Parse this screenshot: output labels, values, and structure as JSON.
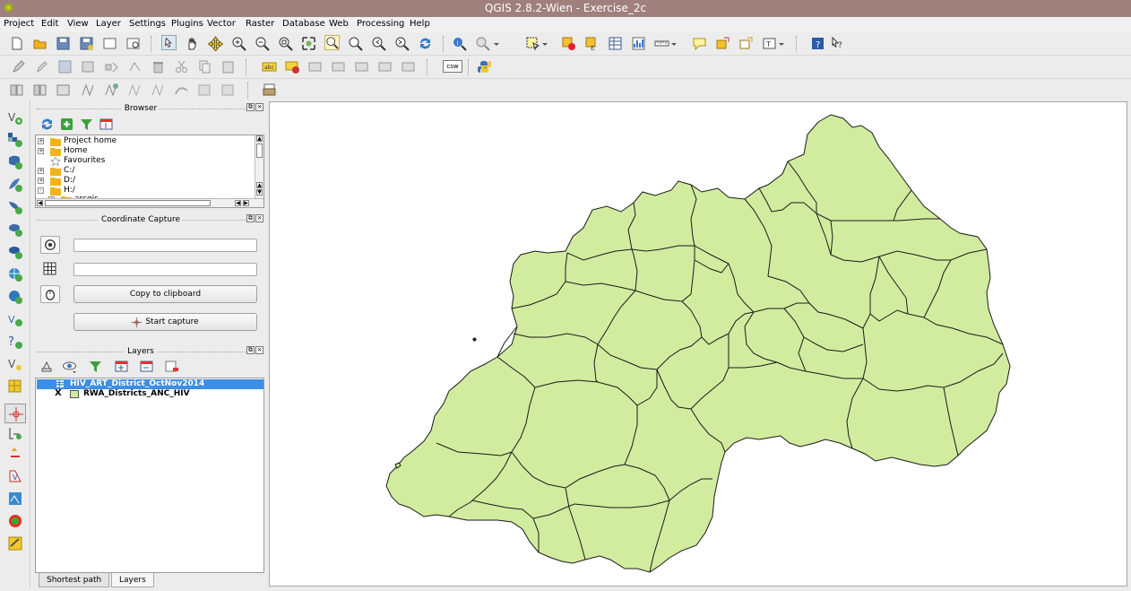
{
  "window": {
    "title": "QGIS 2.8.2-Wien - Exercise_2c"
  },
  "menu": [
    "Project",
    "Edit",
    "View",
    "Layer",
    "Settings",
    "Plugins",
    "Vector",
    "Raster",
    "Database",
    "Web",
    "Processing",
    "Help"
  ],
  "toolbar": {
    "csw_label": "csw"
  },
  "browser": {
    "title": "Browser",
    "items": [
      {
        "label": "Project home",
        "expander": "+"
      },
      {
        "label": "Home",
        "expander": "+"
      },
      {
        "label": "Favourites",
        "expander": ""
      },
      {
        "label": "C:/",
        "expander": "+"
      },
      {
        "label": "D:/",
        "expander": "+"
      },
      {
        "label": "H:/",
        "expander": "-"
      },
      {
        "label": "arcgis",
        "expander": "+"
      }
    ]
  },
  "coordinate_capture": {
    "title": "Coordinate Capture",
    "field1_value": "",
    "field2_value": "",
    "copy_label": "Copy to clipboard",
    "start_label": "Start capture"
  },
  "layers": {
    "title": "Layers",
    "items": [
      {
        "label": "HIV_ART_District_OctNov2014",
        "selected": true
      },
      {
        "label": "RWA_Districts_ANC_HIV",
        "checked": "X",
        "swatch": "#cfeaa0"
      }
    ]
  },
  "tabs": {
    "shortest_path": "Shortest path",
    "layers": "Layers"
  },
  "map": {
    "fill_color": "#d1ec9f",
    "stroke_color": "#1a1a1a"
  },
  "colors": {
    "titlebar": "#a0807c",
    "selection": "#3d8ee6"
  }
}
